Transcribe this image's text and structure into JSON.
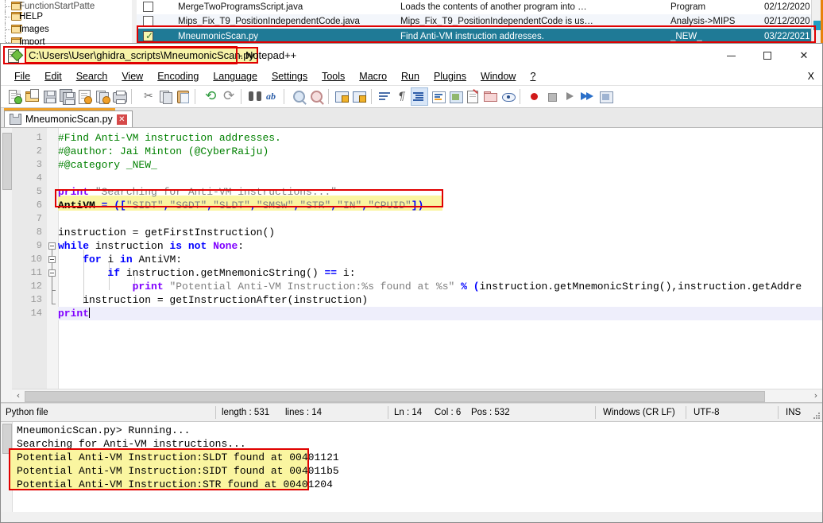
{
  "ghidra": {
    "tree_items": [
      {
        "label": "FunctionStartPatte",
        "clipped": true
      },
      {
        "label": "HELP",
        "clipped": false
      },
      {
        "label": "Images",
        "clipped": false
      },
      {
        "label": "Import",
        "clipped": false
      }
    ],
    "rows": [
      {
        "name": "MergeTwoProgramsScript.java",
        "description": "Loads the contents of another program into …",
        "category": "Program",
        "date": "02/12/2020",
        "checked": false,
        "selected": false
      },
      {
        "name": "Mips_Fix_T9_PositionIndependentCode.java",
        "description": "Mips_Fix_T9_PositionIndependentCode is us…",
        "category": "Analysis->MIPS",
        "date": "02/12/2020",
        "checked": false,
        "selected": false
      },
      {
        "name": "MneumonicScan.py",
        "description": "Find Anti-VM instruction addresses.",
        "category": "_NEW_",
        "date": "03/22/2021",
        "checked": true,
        "selected": true
      }
    ]
  },
  "window": {
    "title_path": "C:\\Users\\User\\ghidra_scripts\\MneumonicScan.py",
    "title_suffix": "- Notepad++",
    "minimize_label": "–",
    "maximize_label": "□",
    "close_label": "✕"
  },
  "menubar": {
    "items": [
      "File",
      "Edit",
      "Search",
      "View",
      "Encoding",
      "Language",
      "Settings",
      "Tools",
      "Macro",
      "Run",
      "Plugins",
      "Window",
      "?"
    ],
    "close_doc_label": "X"
  },
  "toolbar": {
    "icons": [
      "new-file-icon",
      "open-file-icon",
      "save-icon",
      "save-all-icon",
      "close-file-icon",
      "close-all-icon",
      "print-icon",
      "cut-icon",
      "copy-icon",
      "paste-icon",
      "undo-icon",
      "redo-icon",
      "find-icon",
      "replace-icon",
      "zoom-in-icon",
      "zoom-out-icon",
      "sync-vertical-icon",
      "sync-horizontal-icon",
      "word-wrap-icon",
      "show-all-characters-icon",
      "indent-guide-icon",
      "user-defined-dialog-icon",
      "document-map-icon",
      "function-list-icon",
      "folder-workspace-icon",
      "monitoring-icon",
      "record-macro-icon",
      "stop-record-icon",
      "playback-icon",
      "run-macro-multiple-icon",
      "run-icon"
    ]
  },
  "tab": {
    "label": "MneumonicScan.py",
    "close_label": "✕",
    "icon": "save-icon"
  },
  "editor": {
    "line_numbers": [
      "1",
      "2",
      "3",
      "4",
      "5",
      "6",
      "7",
      "8",
      "9",
      "10",
      "11",
      "12",
      "13",
      "14"
    ],
    "lines": [
      {
        "n": 1,
        "text": "#Find Anti-VM instruction addresses."
      },
      {
        "n": 2,
        "text": "#@author: Jai Minton (@CyberRaiju)"
      },
      {
        "n": 3,
        "text": "#@category _NEW_"
      },
      {
        "n": 4,
        "text": ""
      },
      {
        "n": 5,
        "text": "print \"Searching for Anti-VM instructions...\""
      },
      {
        "n": 6,
        "text": "AntiVM = ([\"SIDT\",\"SGDT\",\"SLDT\",\"SMSW\",\"STR\",\"IN\",\"CPUID\"])"
      },
      {
        "n": 7,
        "text": ""
      },
      {
        "n": 8,
        "text": "instruction = getFirstInstruction()"
      },
      {
        "n": 9,
        "text": "while instruction is not None:"
      },
      {
        "n": 10,
        "text": "    for i in AntiVM:"
      },
      {
        "n": 11,
        "text": "        if instruction.getMnemonicString() == i:"
      },
      {
        "n": 12,
        "text": "            print \"Potential Anti-VM Instruction:%s found at %s\" % (instruction.getMnemonicString(),instruction.getAddre"
      },
      {
        "n": 13,
        "text": "    instruction = getInstructionAfter(instruction)"
      },
      {
        "n": 14,
        "text": "print"
      }
    ],
    "highlighted_line": 6,
    "cursor_line": 14,
    "hscroll_left_arrow": "‹",
    "hscroll_right_arrow": "›"
  },
  "statusbar": {
    "file_type": "Python file",
    "length_label": "length : 531",
    "lines_label": "lines : 14",
    "ln": "Ln : 14",
    "col": "Col : 6",
    "pos": "Pos : 532",
    "eol": "Windows (CR LF)",
    "encoding": "UTF-8",
    "insert_mode": "INS"
  },
  "console": {
    "lines": [
      "MneumonicScan.py> Running...",
      "Searching for Anti-VM instructions...",
      "Potential Anti-VM Instruction:SLDT found at 00401121",
      "Potential Anti-VM Instruction:SIDT found at 004011b5",
      "Potential Anti-VM Instruction:STR found at 00401204"
    ],
    "highlighted_from": 2,
    "highlighted_to": 4
  },
  "colors": {
    "annotation_red": "#e00000",
    "highlight_yellow": "#faf5a0",
    "selection_teal": "#1f7a96",
    "tab_accent_orange": "#f0a22a",
    "comment_green": "#008000",
    "keyword_blue": "#0000ff",
    "string_gray": "#808080"
  }
}
